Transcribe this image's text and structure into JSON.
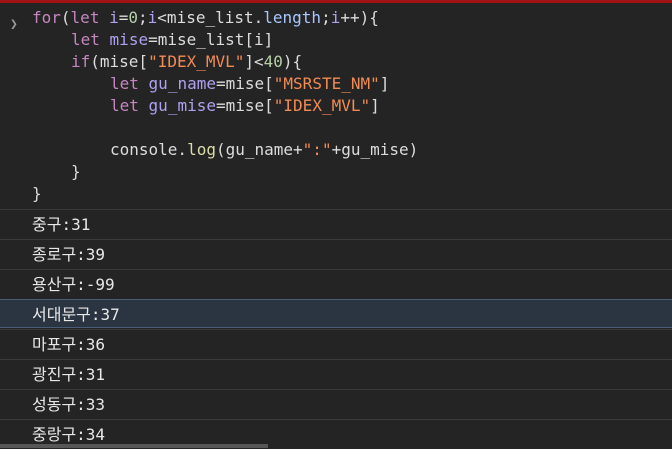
{
  "console": {
    "prompt_icon": "chevron-right-icon",
    "code_lines": [
      {
        "indent": 0,
        "tokens": [
          {
            "t": "kw",
            "v": "for"
          },
          {
            "t": "txt",
            "v": "("
          },
          {
            "t": "kw",
            "v": "let"
          },
          {
            "t": "txt",
            "v": " "
          },
          {
            "t": "var",
            "v": "i"
          },
          {
            "t": "txt",
            "v": "="
          },
          {
            "t": "num",
            "v": "0"
          },
          {
            "t": "txt",
            "v": ";"
          },
          {
            "t": "var",
            "v": "i"
          },
          {
            "t": "txt",
            "v": "<mise_list."
          },
          {
            "t": "prop",
            "v": "length"
          },
          {
            "t": "txt",
            "v": ";"
          },
          {
            "t": "var",
            "v": "i"
          },
          {
            "t": "txt",
            "v": "++){"
          }
        ]
      },
      {
        "indent": 1,
        "tokens": [
          {
            "t": "kw",
            "v": "let"
          },
          {
            "t": "txt",
            "v": " "
          },
          {
            "t": "var",
            "v": "mise"
          },
          {
            "t": "txt",
            "v": "=mise_list[i]"
          }
        ]
      },
      {
        "indent": 1,
        "tokens": [
          {
            "t": "kw",
            "v": "if"
          },
          {
            "t": "txt",
            "v": "(mise["
          },
          {
            "t": "str",
            "v": "\"IDEX_MVL\""
          },
          {
            "t": "txt",
            "v": "]<"
          },
          {
            "t": "num",
            "v": "40"
          },
          {
            "t": "txt",
            "v": "){"
          }
        ]
      },
      {
        "indent": 2,
        "tokens": [
          {
            "t": "kw",
            "v": "let"
          },
          {
            "t": "txt",
            "v": " "
          },
          {
            "t": "var",
            "v": "gu_name"
          },
          {
            "t": "txt",
            "v": "=mise["
          },
          {
            "t": "str",
            "v": "\"MSRSTE_NM\""
          },
          {
            "t": "txt",
            "v": "]"
          }
        ]
      },
      {
        "indent": 2,
        "tokens": [
          {
            "t": "kw",
            "v": "let"
          },
          {
            "t": "txt",
            "v": " "
          },
          {
            "t": "var",
            "v": "gu_mise"
          },
          {
            "t": "txt",
            "v": "=mise["
          },
          {
            "t": "str",
            "v": "\"IDEX_MVL\""
          },
          {
            "t": "txt",
            "v": "]"
          }
        ]
      },
      {
        "indent": 2,
        "tokens": []
      },
      {
        "indent": 2,
        "tokens": [
          {
            "t": "txt",
            "v": "console."
          },
          {
            "t": "fn",
            "v": "log"
          },
          {
            "t": "txt",
            "v": "(gu_name+"
          },
          {
            "t": "str",
            "v": "\":\""
          },
          {
            "t": "txt",
            "v": "+gu_mise)"
          }
        ]
      },
      {
        "indent": 1,
        "tokens": [
          {
            "t": "txt",
            "v": "}"
          }
        ]
      },
      {
        "indent": 0,
        "tokens": [
          {
            "t": "txt",
            "v": "}"
          }
        ]
      }
    ],
    "output_rows": [
      {
        "text": "중구:31",
        "highlighted": false
      },
      {
        "text": "종로구:39",
        "highlighted": false
      },
      {
        "text": "용산구:-99",
        "highlighted": false
      },
      {
        "text": "서대문구:37",
        "highlighted": true
      },
      {
        "text": "마포구:36",
        "highlighted": false
      },
      {
        "text": "광진구:31",
        "highlighted": false
      },
      {
        "text": "성동구:33",
        "highlighted": false
      },
      {
        "text": "중랑구:34",
        "highlighted": false
      }
    ]
  }
}
